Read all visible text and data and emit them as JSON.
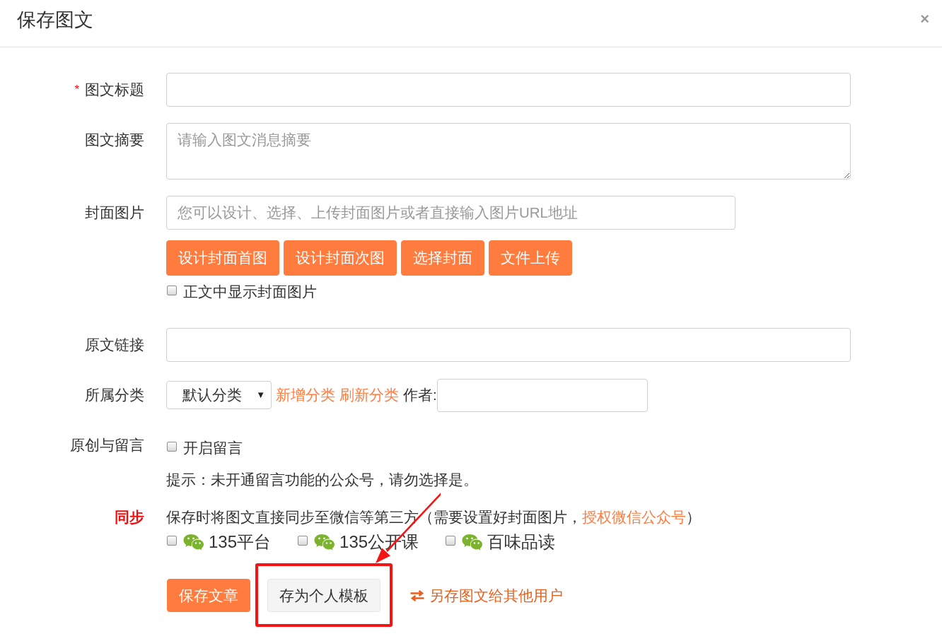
{
  "dialog": {
    "title": "保存图文",
    "close": "×"
  },
  "form": {
    "rows": [
      {
        "kind": "input",
        "label": "图文标题",
        "required_mark": "*"
      },
      {
        "kind": "textarea",
        "label": "图文摘要",
        "placeholder": "请输入图文消息摘要"
      },
      {
        "kind": "cover",
        "label": "封面图片",
        "placeholder": "您可以设计、选择、上传封面图片或者直接输入图片URL地址",
        "buttons": [
          "设计封面首图",
          "设计封面次图",
          "选择封面",
          "文件上传"
        ],
        "option": {
          "label": "正文中显示封面图片",
          "checked": false
        }
      },
      {
        "kind": "input",
        "label": "原文链接"
      },
      {
        "kind": "category",
        "label": "所属分类",
        "select": {
          "value": "默认分类",
          "caret": "▼"
        },
        "links": [
          "新增分类",
          "刷新分类"
        ],
        "author_label": "作者:"
      },
      {
        "kind": "comment",
        "label": "原创与留言",
        "option": {
          "label": "开启留言",
          "checked": false
        },
        "hint": "提示：未开通留言功能的公众号，请勿选择是。"
      },
      {
        "kind": "sync",
        "label": "同步",
        "description": "保存时将图文直接同步至微信等第三方（需要设置好封面图片，",
        "link": "授权微信公众号",
        "description_end": "）",
        "accounts": [
          {
            "name": "135平台",
            "checked": false
          },
          {
            "name": "135公开课",
            "checked": false
          },
          {
            "name": "百味品读",
            "checked": false
          }
        ]
      }
    ]
  },
  "actions": [
    {
      "kind": "primary",
      "label": "保存文章",
      "highlighted": false
    },
    {
      "kind": "default",
      "label": "存为个人模板",
      "highlighted": true
    },
    {
      "kind": "link",
      "label": "另存图文给其他用户",
      "highlighted": false
    }
  ]
}
